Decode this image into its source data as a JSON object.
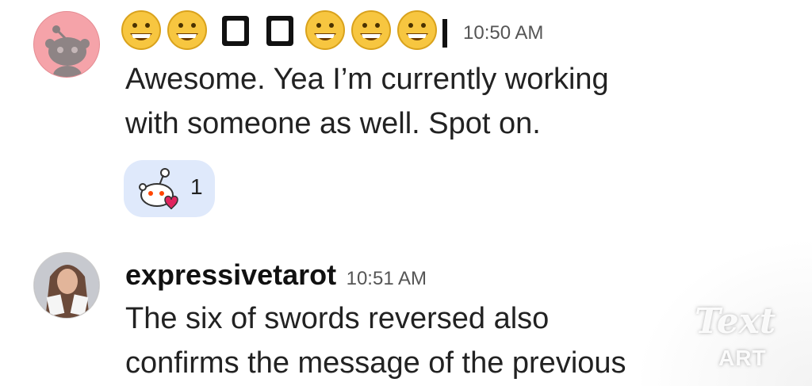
{
  "messages": [
    {
      "username": "",
      "timestamp": "10:50 AM",
      "text_line1": "Awesome. Yea I’m currently working",
      "text_line2": "with someone as well. Spot on.",
      "reaction": {
        "icon": "snoo-heart-icon",
        "count": "1"
      }
    },
    {
      "username": "expressivetarot",
      "timestamp": "10:51 AM",
      "text_line1": "The six of swords reversed also",
      "text_line2": "confirms the message of the previous"
    }
  ],
  "watermark": {
    "script": "Text",
    "sub": "ART"
  },
  "colors": {
    "reaction_bg": "#dfe9fb",
    "avatar_pink": "#f5a3a9",
    "emoji_yellow": "#f7c640"
  }
}
